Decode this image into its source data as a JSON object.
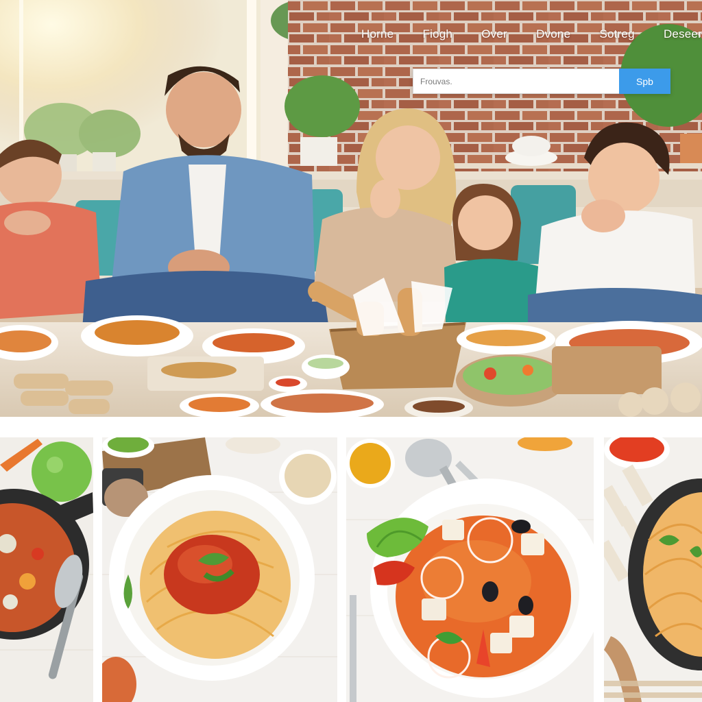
{
  "nav": {
    "items": [
      {
        "label": "Horne"
      },
      {
        "label": "Fiogh"
      },
      {
        "label": "Over"
      },
      {
        "label": "Dvone"
      },
      {
        "label": "Sotreg"
      },
      {
        "label": "Deseer"
      }
    ]
  },
  "search": {
    "placeholder": "Frouvas.",
    "button_label": "Spb"
  },
  "tiles": [
    {
      "icon": "stir-fry-skillet-dish"
    },
    {
      "icon": "spaghetti-tomato-sauce-dish"
    },
    {
      "icon": "tomato-soup-bowl-dish"
    },
    {
      "icon": "noodles-pan-dish"
    }
  ],
  "colors": {
    "search_button": "#3c9bea",
    "nav_text": "#ffffff",
    "brick_wall": "#b56a4e",
    "sofa_teal": "#4aa7a8"
  }
}
